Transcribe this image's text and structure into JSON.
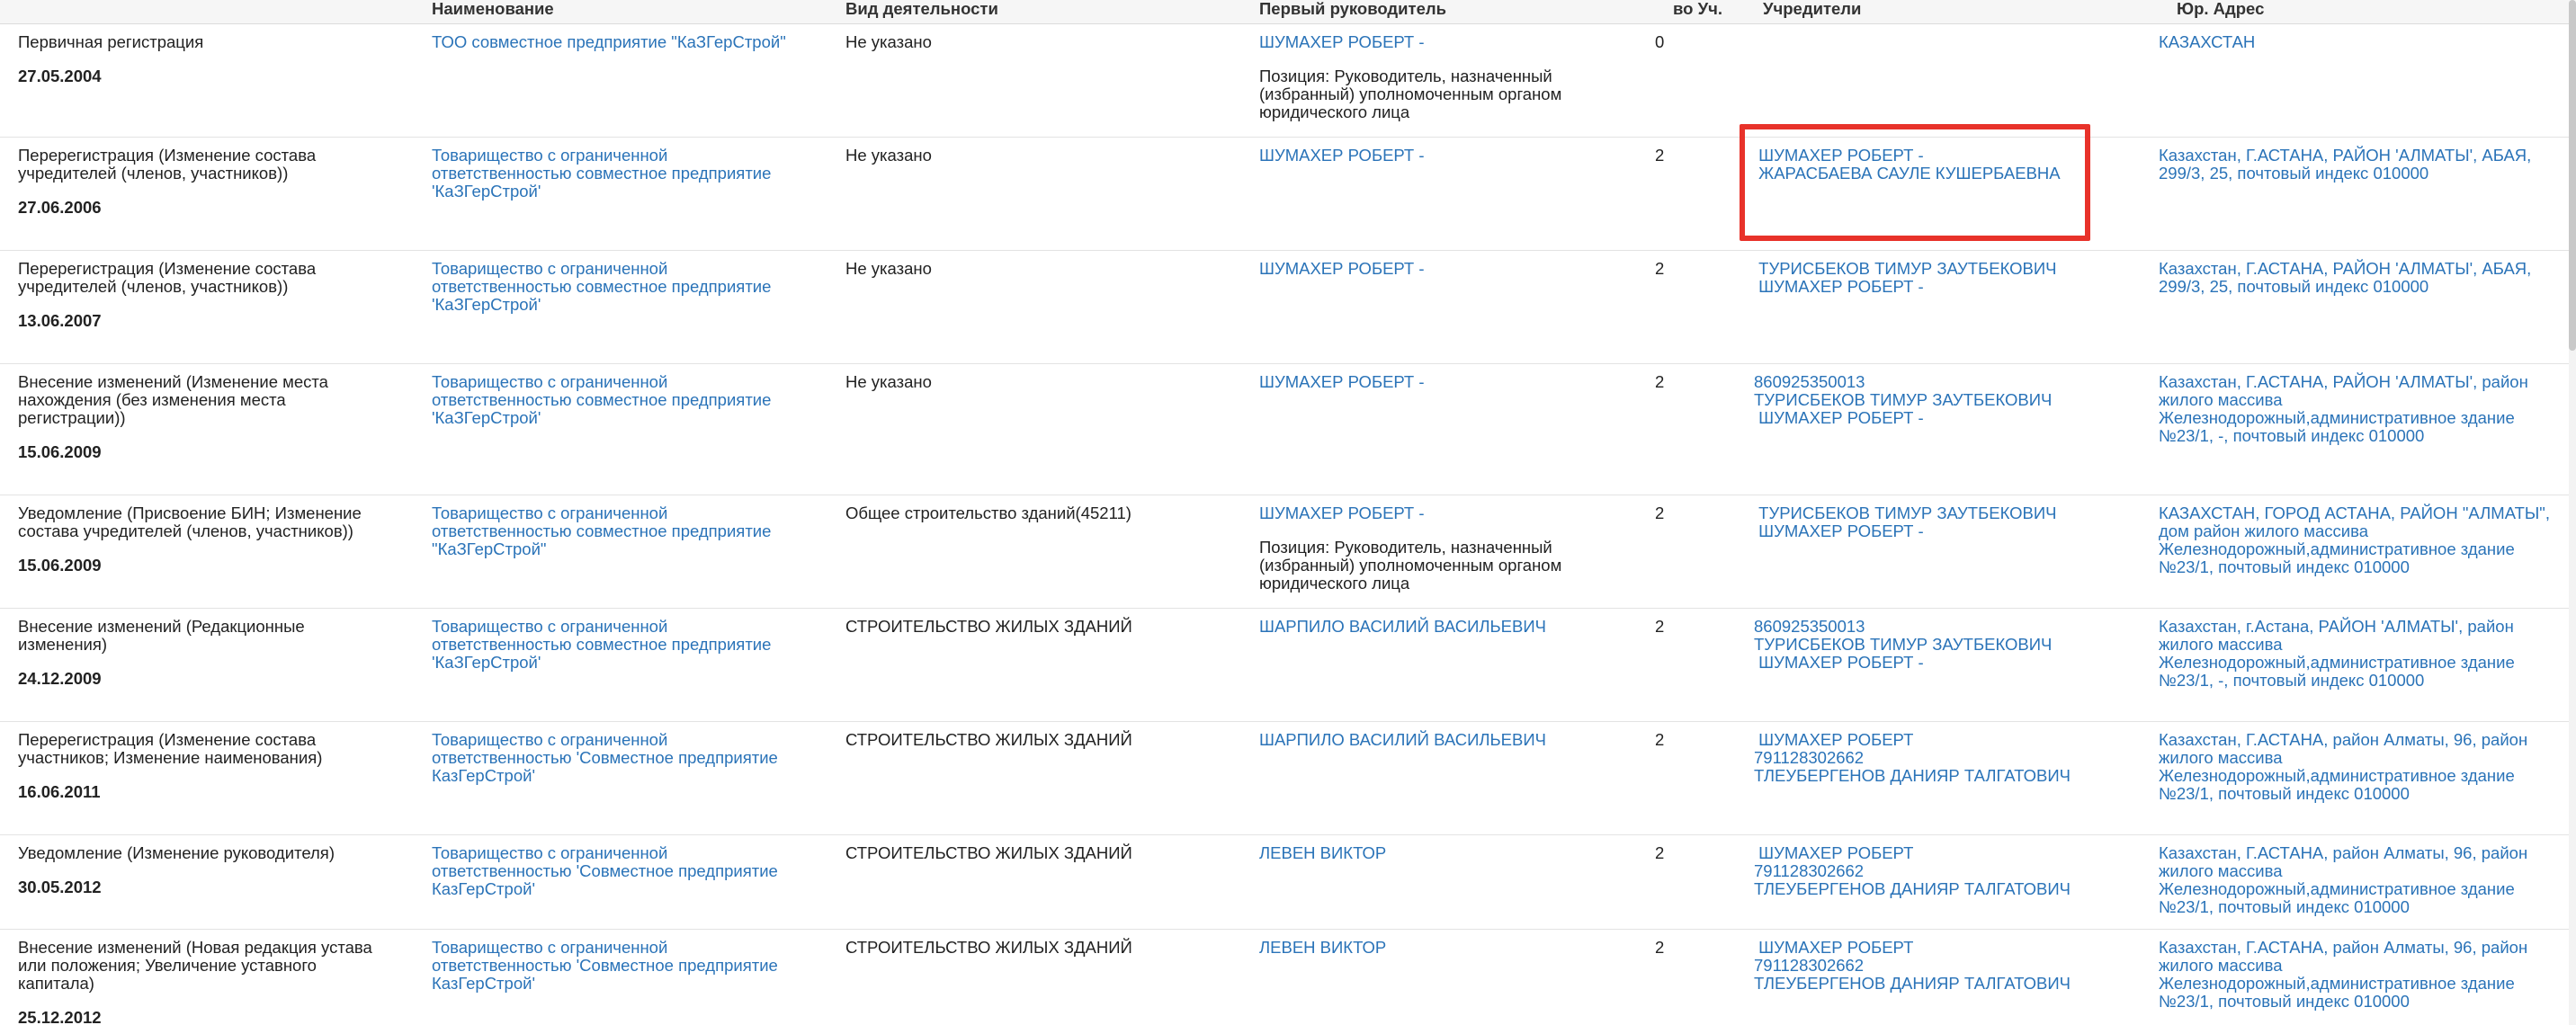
{
  "header": {
    "col_event": "",
    "col_name": "Наименование",
    "col_activity": "Вид деятельности",
    "col_head": "Первый руководитель",
    "col_count": "во Уч.",
    "col_founders": "Учредители",
    "col_address": "Юр. Адрес"
  },
  "rows": [
    {
      "type": "Первичная регистрация",
      "date": "27.05.2004",
      "name": "ТОО совместное предприятие \"КаЗГерСтрой\"",
      "activity": "Не указано",
      "head": "ШУМАХЕР РОБЕРТ -",
      "head_position": "Позиция: Руководитель, назначенный\n(избранный) уполномоченным органом\nюридического лица",
      "count": "0",
      "founders": [],
      "address": "КАЗАХСТАН"
    },
    {
      "type": "Перерегистрация (Изменение состава\nучредителей (членов, участников))",
      "date": "27.06.2006",
      "name": "Товарищество с ограниченной\nответственностью совместное предприятие\n'КаЗГерСтрой'",
      "activity": "Не указано",
      "head": "ШУМАХЕР РОБЕРТ -",
      "head_position": "",
      "count": "2",
      "founders": [
        " ШУМАХЕР РОБЕРТ -",
        " ЖАРАСБАЕВА САУЛЕ КУШЕРБАЕВНА"
      ],
      "address": "Казахстан, Г.АСТАНА, РАЙОН 'АЛМАТЫ', АБАЯ,\n299/3, 25, почтовый индекс 010000"
    },
    {
      "type": "Перерегистрация (Изменение состава\nучредителей (членов, участников))",
      "date": "13.06.2007",
      "name": "Товарищество с ограниченной\nответственностью совместное предприятие\n'КаЗГерСтрой'",
      "activity": "Не указано",
      "head": "ШУМАХЕР РОБЕРТ -",
      "head_position": "",
      "count": "2",
      "founders": [
        " ТУРИСБЕКОВ ТИМУР ЗАУТБЕКОВИЧ",
        " ШУМАХЕР РОБЕРТ -"
      ],
      "address": "Казахстан, Г.АСТАНА, РАЙОН 'АЛМАТЫ', АБАЯ,\n299/3, 25, почтовый индекс 010000"
    },
    {
      "type": "Внесение изменений (Изменение места\nнахождения (без изменения места\nрегистрации))",
      "date": "15.06.2009",
      "name": "Товарищество с ограниченной\nответственностью совместное предприятие\n'КаЗГерСтрой'",
      "activity": "Не указано",
      "head": "ШУМАХЕР РОБЕРТ -",
      "head_position": "",
      "count": "2",
      "founders": [
        "860925350013",
        "ТУРИСБЕКОВ ТИМУР ЗАУТБЕКОВИЧ",
        " ШУМАХЕР РОБЕРТ -"
      ],
      "address": "Казахстан, Г.АСТАНА, РАЙОН 'АЛМАТЫ', район\nжилого массива\nЖелезнодорожный,административное здание\n№23/1, -, почтовый индекс 010000"
    },
    {
      "type": "Уведомление (Присвоение БИН; Изменение\nсостава учредителей (членов, участников))",
      "date": "15.06.2009",
      "name": "Товарищество с ограниченной\nответственностью совместное предприятие\n\"КаЗГерСтрой\"",
      "activity": "Общее строительство зданий(45211)",
      "head": "ШУМАХЕР РОБЕРТ -",
      "head_position": "Позиция: Руководитель, назначенный\n(избранный) уполномоченным органом\nюридического лица",
      "count": "2",
      "founders": [
        " ТУРИСБЕКОВ ТИМУР ЗАУТБЕКОВИЧ",
        " ШУМАХЕР РОБЕРТ -"
      ],
      "address": "КАЗАХСТАН, ГОРОД АСТАНА, РАЙОН \"АЛМАТЫ\",\nдом район жилого массива\nЖелезнодорожный,административное здание\n№23/1, почтовый индекс 010000"
    },
    {
      "type": "Внесение изменений (Редакционные\nизменения)",
      "date": "24.12.2009",
      "name": "Товарищество с ограниченной\nответственностью совместное предприятие\n'КаЗГерСтрой'",
      "activity": "СТРОИТЕЛЬСТВО ЖИЛЫХ ЗДАНИЙ",
      "head": "ШАРПИЛО ВАСИЛИЙ ВАСИЛЬЕВИЧ",
      "head_position": "",
      "count": "2",
      "founders": [
        "860925350013",
        "ТУРИСБЕКОВ ТИМУР ЗАУТБЕКОВИЧ",
        " ШУМАХЕР РОБЕРТ -"
      ],
      "address": "Казахстан, г.Астана, РАЙОН 'АЛМАТЫ', район\nжилого массива\nЖелезнодорожный,административное здание\n№23/1, -, почтовый индекс 010000"
    },
    {
      "type": "Перерегистрация (Изменение состава\nучастников; Изменение наименования)",
      "date": "16.06.2011",
      "name": "Товарищество с ограниченной\nответственностью 'Совместное предприятие\nКазГерСтрой'",
      "activity": "СТРОИТЕЛЬСТВО ЖИЛЫХ ЗДАНИЙ",
      "head": "ШАРПИЛО ВАСИЛИЙ ВАСИЛЬЕВИЧ",
      "head_position": "",
      "count": "2",
      "founders": [
        " ШУМАХЕР РОБЕРТ",
        "791128302662",
        "ТЛЕУБЕРГЕНОВ ДАНИЯР ТАЛГАТОВИЧ"
      ],
      "address": "Казахстан, Г.АСТАНА, район Алматы, 96, район\nжилого массива\nЖелезнодорожный,административное здание\n№23/1, почтовый индекс 010000"
    },
    {
      "type": "Уведомление (Изменение руководителя)",
      "date": "30.05.2012",
      "name": "Товарищество с ограниченной\nответственностью 'Совместное предприятие\nКазГерСтрой'",
      "activity": "СТРОИТЕЛЬСТВО ЖИЛЫХ ЗДАНИЙ",
      "head": "ЛЕВЕН ВИКТОР",
      "head_position": "",
      "count": "2",
      "founders": [
        " ШУМАХЕР РОБЕРТ",
        "791128302662",
        "ТЛЕУБЕРГЕНОВ ДАНИЯР ТАЛГАТОВИЧ"
      ],
      "address": "Казахстан, Г.АСТАНА, район Алматы, 96, район\nжилого массива\nЖелезнодорожный,административное здание\n№23/1, почтовый индекс 010000"
    },
    {
      "type": "Внесение изменений (Новая редакция устава\nили положения; Увеличение уставного\nкапитала)",
      "date": "25.12.2012",
      "name": "Товарищество с ограниченной\nответственностью 'Совместное предприятие\nКазГерСтрой'",
      "activity": "СТРОИТЕЛЬСТВО ЖИЛЫХ ЗДАНИЙ",
      "head": "ЛЕВЕН ВИКТОР",
      "head_position": "",
      "count": "2",
      "founders": [
        " ШУМАХЕР РОБЕРТ",
        "791128302662",
        "ТЛЕУБЕРГЕНОВ ДАНИЯР ТАЛГАТОВИЧ"
      ],
      "address": "Казахстан, Г.АСТАНА, район Алматы, 96, район\nжилого массива\nЖелезнодорожный,административное здание\n№23/1, почтовый индекс 010000"
    }
  ],
  "colors": {
    "link": "#2a73b8",
    "annotation": "#e8322a",
    "header_bg": "#f6f6f6"
  }
}
